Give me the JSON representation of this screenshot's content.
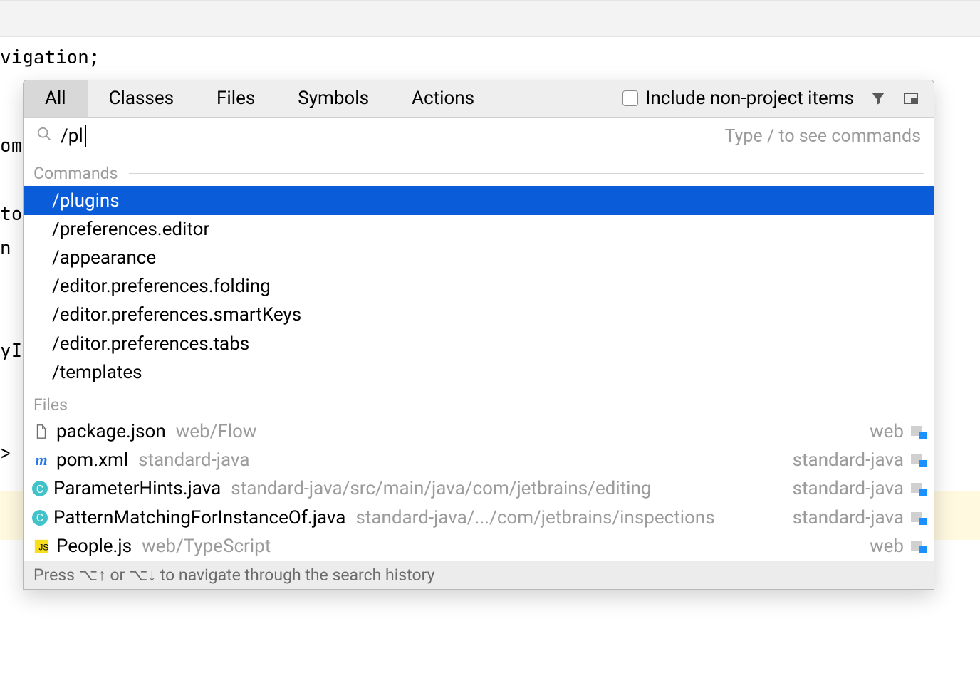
{
  "background": {
    "code_line": "vigation;",
    "left_fragments": "om\n\nto\nn\n\n\nyI\n\n\n>"
  },
  "popup": {
    "tabs": [
      "All",
      "Classes",
      "Files",
      "Symbols",
      "Actions"
    ],
    "active_tab_index": 0,
    "include_label": "Include non-project items",
    "search_value": "/pl",
    "search_hint": "Type / to see commands",
    "sections": {
      "commands_label": "Commands",
      "files_label": "Files"
    },
    "commands": [
      {
        "label": "/plugins",
        "selected": true
      },
      {
        "label": "/preferences.editor"
      },
      {
        "label": "/appearance"
      },
      {
        "label": "/editor.preferences.folding"
      },
      {
        "label": "/editor.preferences.smartKeys"
      },
      {
        "label": "/editor.preferences.tabs"
      },
      {
        "label": "/templates"
      }
    ],
    "files": [
      {
        "icon": "json",
        "name": "package.json",
        "path": "web/Flow",
        "module": "web"
      },
      {
        "icon": "m",
        "name": "pom.xml",
        "path": "standard-java",
        "module": "standard-java"
      },
      {
        "icon": "cls",
        "name": "ParameterHints.java",
        "path": "standard-java/src/main/java/com/jetbrains/editing",
        "module": "standard-java"
      },
      {
        "icon": "cls",
        "name": "PatternMatchingForInstanceOf.java",
        "path": "standard-java/.../com/jetbrains/inspections",
        "module": "standard-java"
      },
      {
        "icon": "js",
        "name": "People.js",
        "path": "web/TypeScript",
        "module": "web"
      }
    ],
    "footer_hint": "Press ⌥↑ or ⌥↓ to navigate through the search history"
  }
}
